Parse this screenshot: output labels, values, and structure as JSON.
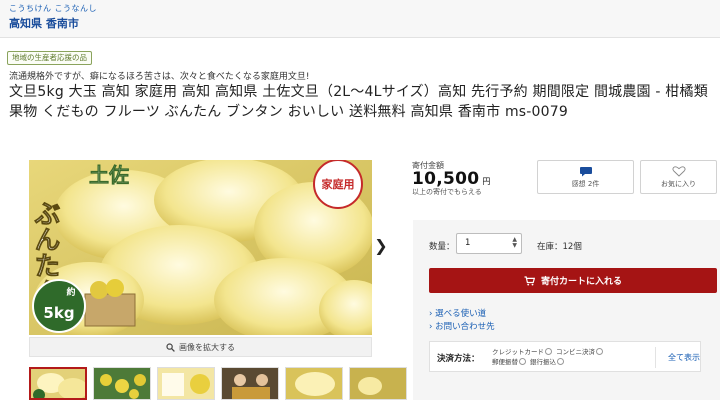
{
  "header": {
    "furigana": "こうちけん こうなんし",
    "municipality": "高知県 香南市"
  },
  "product": {
    "badge": "地域の生産者応援の品",
    "subcopy": "流通規格外ですが、癖になるほろ苦さは、次々と食べたくなる家庭用文旦!",
    "title": "文旦5kg 大玉 高知 家庭用 高知 高知県 土佐文旦（2L〜4Lサイズ）高知 先行予約 期間限定 間城農園 - 柑橘類 果物 くだもの フルーツ ぶんたん ブンタン おいしい 送料無料 高知県 香南市 ms-0079"
  },
  "gallery": {
    "image_text_tosa": "土佐",
    "image_text_buntan": "ぶんたん",
    "image_text_home": "家庭用",
    "image_text_approx": "約",
    "image_text_weight": "5kg",
    "zoom_label": "画像を拡大する",
    "zoom_icon": "magnifier-icon",
    "next_icon": "chevron-right-icon"
  },
  "pricing": {
    "label": "寄付金額",
    "amount": "10,500",
    "unit": "円",
    "note": "以上の寄付でもらえる"
  },
  "actions": {
    "review_label": "感想 2件",
    "review_icon": "speech-bubble-icon",
    "favorite_label": "お気に入り",
    "favorite_icon": "heart-icon"
  },
  "order": {
    "quantity_label": "数量：",
    "quantity_value": "1",
    "stock_text": "在庫：12個",
    "cart_label": "寄付カートに入れる",
    "cart_icon": "cart-icon",
    "accent": "#a51414"
  },
  "help": {
    "link1": "選べる使い道",
    "link2": "お問い合わせ先"
  },
  "payment": {
    "label": "決済方法：",
    "methods": [
      "クレジットカード",
      "コンビニ決済",
      "郵便振替",
      "銀行振込"
    ],
    "show_all": "全て表示"
  }
}
